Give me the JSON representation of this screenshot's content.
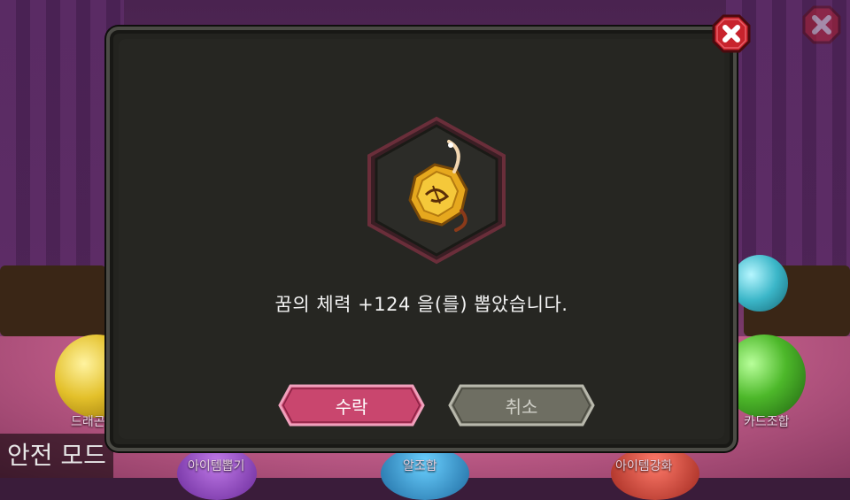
{
  "background": {
    "menu_labels": [
      "드래곤",
      "아이템뽑기",
      "알조합",
      "아이템강화",
      "카드조합"
    ]
  },
  "safe_mode_label": "안전 모드",
  "dialog": {
    "item_icon": "golden-gem-icon",
    "message": "꿈의 체력 +124 을(를) 뽑았습니다.",
    "accept_label": "수락",
    "cancel_label": "취소"
  },
  "colors": {
    "dialog_bg": "#262622",
    "accept_button": "#c9466e",
    "cancel_button": "#6e6e62",
    "close_button": "#c8232c"
  }
}
